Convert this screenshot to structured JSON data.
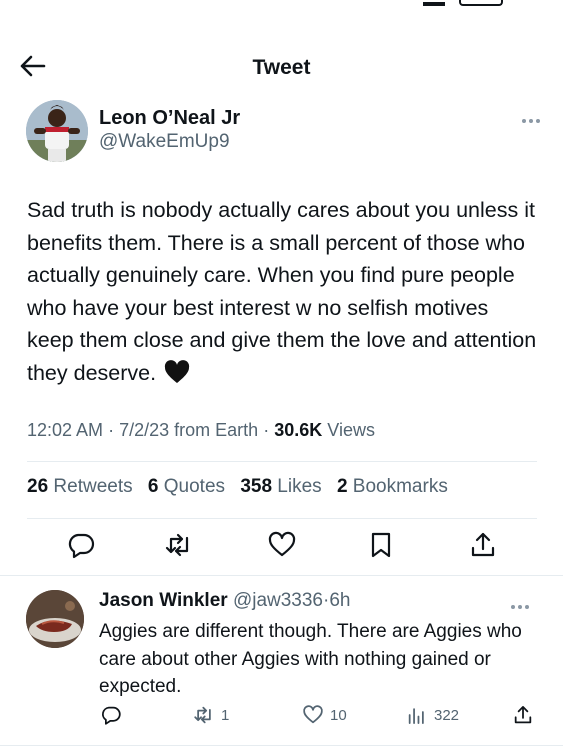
{
  "header": {
    "title": "Tweet"
  },
  "tweet": {
    "author_name": "Leon O’Neal Jr",
    "author_handle": "@WakeEmUp9",
    "text": "Sad truth is nobody actually cares about you unless it benefits them. There is a small percent of those who actually genuinely care. When you find pure people who have your best interest w no selfish motives keep them close and give them the love and attention they deserve.",
    "time": "12:02 AM",
    "dot1": "·",
    "date": "7/2/23",
    "source": "from Earth",
    "dot2": "·",
    "views_count": "30.6K",
    "views_label": "Views",
    "stats": {
      "retweets_count": "26",
      "retweets_label": "Retweets",
      "quotes_count": "6",
      "quotes_label": "Quotes",
      "likes_count": "358",
      "likes_label": "Likes",
      "bookmarks_count": "2",
      "bookmarks_label": "Bookmarks"
    },
    "icons": [
      "reply-icon",
      "retweet-icon",
      "like-icon",
      "bookmark-icon",
      "share-icon"
    ]
  },
  "reply": {
    "name": "Jason Winkler",
    "handle": "@jaw3336",
    "sep": "·",
    "time": "6h",
    "text": "Aggies are different though. There are Aggies who care about other Aggies with nothing gained or expected.",
    "retweets": "1",
    "likes": "10",
    "views": "322"
  },
  "colors": {
    "text": "#0f1419",
    "secondary": "#536471",
    "divider": "#e6ecf0"
  }
}
